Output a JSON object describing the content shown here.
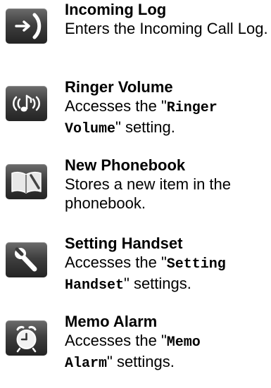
{
  "entries": [
    {
      "icon": "incoming-call-icon",
      "title": "Incoming Log",
      "desc": "Enters the Incoming Call Log."
    },
    {
      "icon": "ringer-volume-icon",
      "title": "Ringer Volume",
      "desc_before": "Accesses the \"",
      "desc_setting_1": "Ringer",
      "desc_setting_2": "Volume",
      "desc_after": "\" setting."
    },
    {
      "icon": "phonebook-icon",
      "title": "New Phonebook",
      "desc": "Stores a new item in the phonebook."
    },
    {
      "icon": "wrench-icon",
      "title": "Setting Handset",
      "desc_before": "Accesses the \"",
      "desc_setting_1": "Setting",
      "desc_setting_2": "Handset",
      "desc_after": "\" settings."
    },
    {
      "icon": "alarm-clock-icon",
      "title": "Memo Alarm",
      "desc_before": "Accesses the \"",
      "desc_setting_1": "Memo",
      "desc_setting_2": "Alarm",
      "desc_after": "\" settings."
    }
  ]
}
